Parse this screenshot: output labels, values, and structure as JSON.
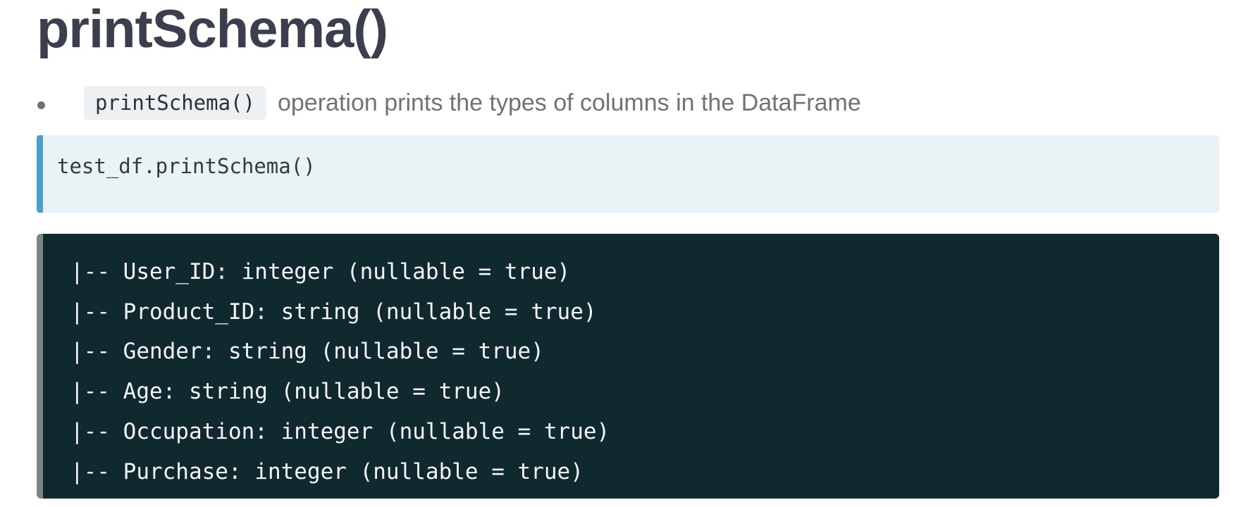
{
  "heading": "printSchema()",
  "bullet": {
    "code": "printSchema()",
    "text": "operation prints the types of columns in the DataFrame"
  },
  "input_cell": {
    "code": "test_df.printSchema()"
  },
  "output_cell": {
    "lines": [
      "|-- User_ID: integer (nullable = true)",
      "|-- Product_ID: string (nullable = true)",
      "|-- Gender: string (nullable = true)",
      "|-- Age: string (nullable = true)",
      "|-- Occupation: integer (nullable = true)",
      "|-- Purchase: integer (nullable = true)"
    ]
  },
  "colors": {
    "heading": "#3b3e4d",
    "input_accent": "#4a9fc8",
    "input_background": "#eaf2f6",
    "output_background": "#10292f",
    "output_accent": "#7d8386",
    "output_text": "#f2f4f5"
  }
}
